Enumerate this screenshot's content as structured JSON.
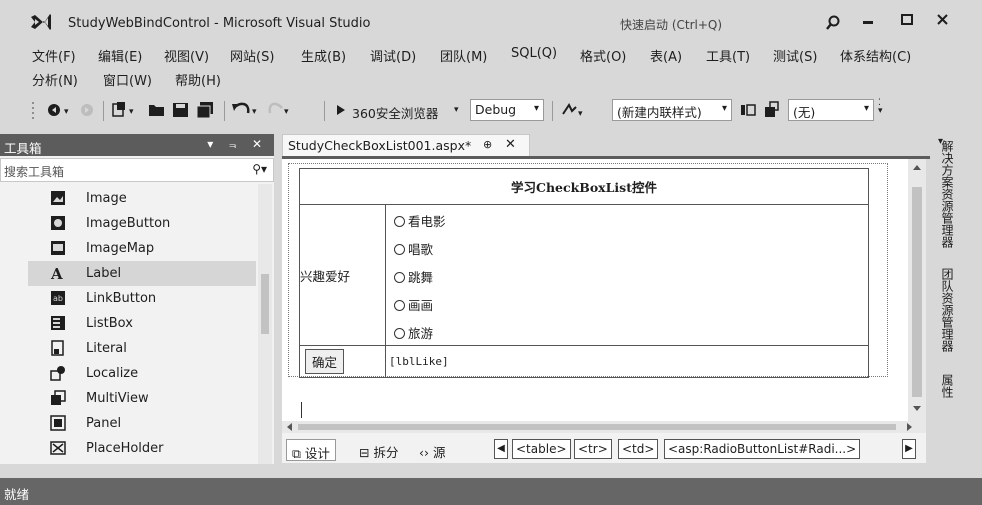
{
  "window": {
    "title": "StudyWebBindControl - Microsoft Visual Studio",
    "quick_launch_placeholder": "快速启动 (Ctrl+Q)"
  },
  "menu": {
    "row1": [
      "文件(F)",
      "编辑(E)",
      "视图(V)",
      "网站(S)",
      "生成(B)",
      "调试(D)",
      "团队(M)",
      "SQL(Q)",
      "格式(O)",
      "表(A)",
      "工具(T)",
      "测试(S)",
      "体系结构(C)"
    ],
    "row2": [
      "分析(N)",
      "窗口(W)",
      "帮助(H)"
    ]
  },
  "toolbar": {
    "browser_label": "360安全浏览器",
    "config_value": "Debug",
    "style_value": "(新建内联样式)",
    "font_value": "(无)"
  },
  "toolbox": {
    "title": "工具箱",
    "pin_label": "▾ ⫬ ✕",
    "search_placeholder": "搜索工具箱",
    "items": [
      {
        "label": "Image",
        "icon": "image-icon"
      },
      {
        "label": "ImageButton",
        "icon": "image-button-icon"
      },
      {
        "label": "ImageMap",
        "icon": "image-map-icon"
      },
      {
        "label": "Label",
        "icon": "label-icon",
        "selected": true
      },
      {
        "label": "LinkButton",
        "icon": "link-button-icon"
      },
      {
        "label": "ListBox",
        "icon": "list-box-icon"
      },
      {
        "label": "Literal",
        "icon": "literal-icon"
      },
      {
        "label": "Localize",
        "icon": "localize-icon"
      },
      {
        "label": "MultiView",
        "icon": "multi-view-icon"
      },
      {
        "label": "Panel",
        "icon": "panel-icon"
      },
      {
        "label": "PlaceHolder",
        "icon": "placeholder-icon"
      }
    ]
  },
  "document": {
    "tab_label": "StudyCheckBoxList001.aspx*",
    "table_caption": "学习CheckBoxList控件",
    "row_label": "兴趣爱好",
    "options": [
      "看电影",
      "唱歌",
      "跳舞",
      "画画",
      "旅游"
    ],
    "submit_label": "确定",
    "result_label": "[lblLike]"
  },
  "viewbar": {
    "design": "设计",
    "split": "拆分",
    "source": "源",
    "breadcrumbs": [
      "<table>",
      "<tr>",
      "<td>",
      "<asp:RadioButtonList#Radi...>"
    ]
  },
  "side_tabs": [
    "解决方案资源管理器",
    "团队资源管理器",
    "属性"
  ],
  "status": {
    "text": "就绪"
  },
  "colors": {
    "chrome": "#d8d8d8",
    "panel_header": "#5c5c5c",
    "status_bar": "#666666"
  }
}
